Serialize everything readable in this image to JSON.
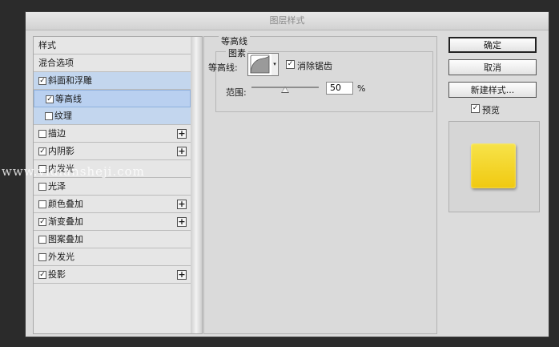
{
  "dialog": {
    "title": "图层样式"
  },
  "styles_list": {
    "header": "样式",
    "blend_options": "混合选项",
    "items": [
      {
        "label": "斜面和浮雕",
        "checked": true,
        "plus": false
      },
      {
        "label": "等高线",
        "checked": true,
        "plus": false
      },
      {
        "label": "纹理",
        "checked": false,
        "plus": false
      },
      {
        "label": "描边",
        "checked": false,
        "plus": true
      },
      {
        "label": "内阴影",
        "checked": true,
        "plus": true
      },
      {
        "label": "内发光",
        "checked": false,
        "plus": false
      },
      {
        "label": "光泽",
        "checked": false,
        "plus": false
      },
      {
        "label": "颜色叠加",
        "checked": false,
        "plus": true
      },
      {
        "label": "渐变叠加",
        "checked": true,
        "plus": true
      },
      {
        "label": "图案叠加",
        "checked": false,
        "plus": false
      },
      {
        "label": "外发光",
        "checked": false,
        "plus": false
      },
      {
        "label": "投影",
        "checked": true,
        "plus": true
      }
    ],
    "check_mark": "✓",
    "plus_glyph": "+"
  },
  "contour_panel": {
    "group_title": "等高线",
    "subgroup_title": "图素",
    "contour_label": "等高线:",
    "antialias_label": "消除锯齿",
    "antialias_checked": true,
    "range_label": "范围:",
    "range_value": "50",
    "range_unit": "%",
    "range_fraction": 0.5
  },
  "buttons": {
    "ok": "确定",
    "cancel": "取消",
    "new_style": "新建样式..."
  },
  "preview": {
    "label": "预览",
    "checked": true,
    "swatch_color": "#f5d628"
  },
  "watermark": "www.vidiansheji.com"
}
